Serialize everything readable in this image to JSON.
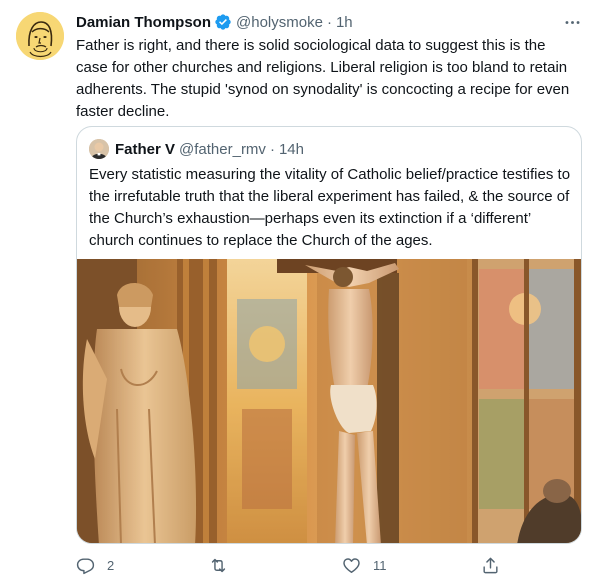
{
  "tweet": {
    "author_name": "Damian Thompson",
    "handle": "@holysmoke",
    "separator": "·",
    "time": "1h",
    "verified": true,
    "text": "Father is right, and there is solid sociological data to suggest this is the case for other churches and religions.  Liberal religion is too bland to retain adherents. The stupid 'synod on synodality' is concocting a recipe for even faster decline."
  },
  "quoted": {
    "author_name": "Father V",
    "handle": "@father_rmv",
    "separator": "·",
    "time": "14h",
    "text": "Every statistic measuring the vitality of Catholic belief/practice testifies to the irrefutable truth that the liberal experiment has failed, & the source of the Church’s exhaustion—perhaps even its extinction if a ‘different’ church continues to replace the Church of the ages."
  },
  "actions": {
    "replies": "2",
    "retweets": "",
    "likes": "11"
  },
  "icons": {
    "more": "more-icon",
    "verified": "verified-badge-icon",
    "reply": "reply-icon",
    "retweet": "retweet-icon",
    "like": "heart-icon",
    "share": "share-icon"
  },
  "colors": {
    "text": "#0f1419",
    "secondary": "#536471",
    "verified": "#1d9bf0",
    "border": "#cfd9de"
  }
}
